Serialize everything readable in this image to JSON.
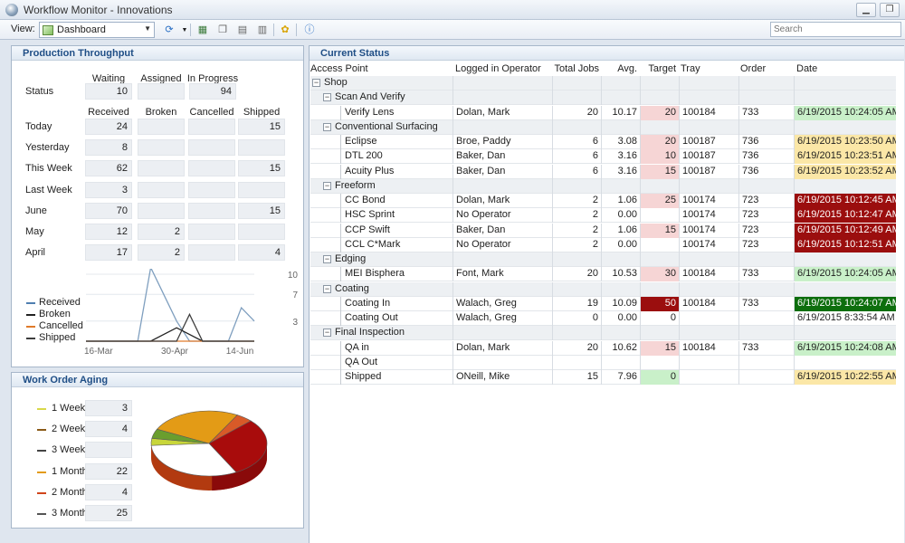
{
  "window": {
    "title": "Workflow Monitor - Innovations"
  },
  "toolbar": {
    "view_label": "View:",
    "view_value": "Dashboard",
    "search_placeholder": "Search"
  },
  "throughput": {
    "title": "Production Throughput",
    "status_headers": [
      "Waiting",
      "Assigned",
      "In Progress"
    ],
    "status_label": "Status",
    "status_values": [
      "10",
      "",
      "94"
    ],
    "headers": [
      "Received",
      "Broken",
      "Cancelled",
      "Shipped"
    ],
    "rows": [
      {
        "label": "Today",
        "values": [
          "24",
          "",
          "",
          "15"
        ]
      },
      {
        "label": "Yesterday",
        "values": [
          "8",
          "",
          "",
          ""
        ]
      },
      {
        "label": "This Week",
        "values": [
          "62",
          "",
          "",
          "15"
        ]
      },
      {
        "label": "Last Week",
        "values": [
          "3",
          "",
          "",
          ""
        ]
      },
      {
        "label": "June",
        "values": [
          "70",
          "",
          "",
          "15"
        ]
      },
      {
        "label": "May",
        "values": [
          "12",
          "2",
          "",
          ""
        ]
      },
      {
        "label": "April",
        "values": [
          "17",
          "2",
          "",
          "4"
        ]
      }
    ],
    "legend": [
      {
        "name": "Received",
        "color": "#4f7fb0"
      },
      {
        "name": "Broken",
        "color": "#222222"
      },
      {
        "name": "Cancelled",
        "color": "#e07a2a"
      },
      {
        "name": "Shipped",
        "color": "#3d3d3d"
      }
    ]
  },
  "chart_data": {
    "type": "line",
    "x_tick_labels": [
      "16-Mar",
      "30-Apr",
      "14-Jun"
    ],
    "y_tick_labels": [
      "10",
      "7",
      "3"
    ],
    "ylim": [
      0,
      10
    ],
    "grid": true,
    "series": [
      {
        "name": "Received",
        "color": "#7f9fbf",
        "values": [
          0,
          0,
          0,
          0,
          0,
          11,
          7,
          3,
          0,
          0,
          0,
          0,
          5,
          3
        ]
      },
      {
        "name": "Broken",
        "color": "#222222",
        "values": [
          0,
          0,
          0,
          0,
          0,
          0,
          1,
          2,
          1,
          0,
          0,
          0,
          0,
          0
        ]
      },
      {
        "name": "Cancelled",
        "color": "#e07a2a",
        "values": [
          0,
          0,
          0,
          0,
          0,
          0,
          0,
          0,
          0,
          0,
          0,
          0,
          0,
          0
        ]
      },
      {
        "name": "Shipped",
        "color": "#3d3d3d",
        "values": [
          0,
          0,
          0,
          0,
          0,
          0,
          0,
          0,
          4,
          0,
          0,
          0,
          0,
          0
        ]
      }
    ]
  },
  "aging": {
    "title": "Work Order Aging",
    "rows": [
      {
        "label": "1 Week",
        "value": "3",
        "color": "#d8d84a"
      },
      {
        "label": "2 Weeks",
        "value": "4",
        "color": "#8a5a18"
      },
      {
        "label": "3 Weeks",
        "value": "",
        "color": "#444444"
      },
      {
        "label": "1 Month",
        "value": "22",
        "color": "#e39b16"
      },
      {
        "label": "2 Months",
        "value": "4",
        "color": "#d0451b"
      },
      {
        "label": "3 Months",
        "value": "25",
        "color": "#555555"
      }
    ],
    "pie": [
      {
        "label": "1 Week",
        "value": 3,
        "color": "#c8d63a"
      },
      {
        "label": "2 Weeks",
        "value": 4,
        "color": "#6a9e2e"
      },
      {
        "label": "1 Month",
        "value": 22,
        "color": "#e39b16"
      },
      {
        "label": "2 Months",
        "value": 4,
        "color": "#d85a28"
      },
      {
        "label": "3 Months",
        "value": 25,
        "color": "#a80c0c"
      },
      {
        "label": "open",
        "value": 27,
        "color": "#ffffff"
      }
    ]
  },
  "status": {
    "title": "Current Status",
    "columns": [
      "Access Point",
      "Logged in Operator",
      "Total Jobs",
      "Avg.",
      "Target",
      "Tray",
      "Order",
      "Date"
    ],
    "rows": [
      {
        "kind": "group",
        "level": 0,
        "label": "Shop"
      },
      {
        "kind": "group",
        "level": 1,
        "label": "Scan And Verify"
      },
      {
        "kind": "item",
        "label": "Verify Lens",
        "operator": "Dolan, Mark",
        "jobs": "20",
        "avg": "10.17",
        "target": "20",
        "target_style": "pink",
        "tray": "100184",
        "order": "733",
        "date": "6/19/2015 10:24:05 AM",
        "date_style": "green"
      },
      {
        "kind": "group",
        "level": 1,
        "label": "Conventional Surfacing"
      },
      {
        "kind": "item",
        "label": "Eclipse",
        "operator": "Broe, Paddy",
        "jobs": "6",
        "avg": "3.08",
        "target": "20",
        "target_style": "pink",
        "tray": "100187",
        "order": "736",
        "date": "6/19/2015 10:23:50 AM",
        "date_style": "yellow"
      },
      {
        "kind": "item",
        "label": "DTL 200",
        "operator": "Baker, Dan",
        "jobs": "6",
        "avg": "3.16",
        "target": "10",
        "target_style": "pink",
        "tray": "100187",
        "order": "736",
        "date": "6/19/2015 10:23:51 AM",
        "date_style": "yellow"
      },
      {
        "kind": "item",
        "label": "Acuity Plus",
        "operator": "Baker, Dan",
        "jobs": "6",
        "avg": "3.16",
        "target": "15",
        "target_style": "pink",
        "tray": "100187",
        "order": "736",
        "date": "6/19/2015 10:23:52 AM",
        "date_style": "yellow"
      },
      {
        "kind": "group",
        "level": 1,
        "label": "Freeform"
      },
      {
        "kind": "item",
        "label": "CC Bond",
        "operator": "Dolan, Mark",
        "jobs": "2",
        "avg": "1.06",
        "target": "25",
        "target_style": "pink",
        "tray": "100174",
        "order": "723",
        "date": "6/19/2015 10:12:45 AM",
        "date_style": "darkred"
      },
      {
        "kind": "item",
        "label": "HSC Sprint",
        "operator": "No Operator",
        "jobs": "2",
        "avg": "0.00",
        "target": "",
        "target_style": "",
        "tray": "100174",
        "order": "723",
        "date": "6/19/2015 10:12:47 AM",
        "date_style": "darkred"
      },
      {
        "kind": "item",
        "label": "CCP Swift",
        "operator": "Baker, Dan",
        "jobs": "2",
        "avg": "1.06",
        "target": "15",
        "target_style": "pink",
        "tray": "100174",
        "order": "723",
        "date": "6/19/2015 10:12:49 AM",
        "date_style": "darkred"
      },
      {
        "kind": "item",
        "label": "CCL C*Mark",
        "operator": "No Operator",
        "jobs": "2",
        "avg": "0.00",
        "target": "",
        "target_style": "",
        "tray": "100174",
        "order": "723",
        "date": "6/19/2015 10:12:51 AM",
        "date_style": "darkred"
      },
      {
        "kind": "group",
        "level": 1,
        "label": "Edging"
      },
      {
        "kind": "item",
        "label": "MEI Bisphera",
        "operator": "Font, Mark",
        "jobs": "20",
        "avg": "10.53",
        "target": "30",
        "target_style": "pink",
        "tray": "100184",
        "order": "733",
        "date": "6/19/2015 10:24:05 AM",
        "date_style": "green"
      },
      {
        "kind": "group",
        "level": 1,
        "label": "Coating"
      },
      {
        "kind": "item",
        "label": "Coating In",
        "operator": "Walach, Greg",
        "jobs": "19",
        "avg": "10.09",
        "target": "50",
        "target_style": "darkred",
        "tray": "100184",
        "order": "733",
        "date": "6/19/2015 10:24:07 AM",
        "date_style": "darkgreen"
      },
      {
        "kind": "item",
        "label": "Coating Out",
        "operator": "Walach, Greg",
        "jobs": "0",
        "avg": "0.00",
        "target": "0",
        "target_style": "",
        "tray": "",
        "order": "",
        "date": "6/19/2015 8:33:54 AM",
        "date_style": ""
      },
      {
        "kind": "group",
        "level": 1,
        "label": "Final Inspection"
      },
      {
        "kind": "item",
        "label": "QA in",
        "operator": "Dolan, Mark",
        "jobs": "20",
        "avg": "10.62",
        "target": "15",
        "target_style": "pink",
        "tray": "100184",
        "order": "733",
        "date": "6/19/2015 10:24:08 AM",
        "date_style": "green"
      },
      {
        "kind": "item",
        "label": "QA Out",
        "operator": "",
        "jobs": "",
        "avg": "",
        "target": "",
        "target_style": "",
        "tray": "",
        "order": "",
        "date": "",
        "date_style": ""
      },
      {
        "kind": "item",
        "label": "Shipped",
        "operator": "ONeill, Mike",
        "jobs": "15",
        "avg": "7.96",
        "target": "0",
        "target_style": "lightgreen",
        "tray": "",
        "order": "",
        "date": "6/19/2015 10:22:55 AM",
        "date_style": "yellow"
      }
    ]
  }
}
